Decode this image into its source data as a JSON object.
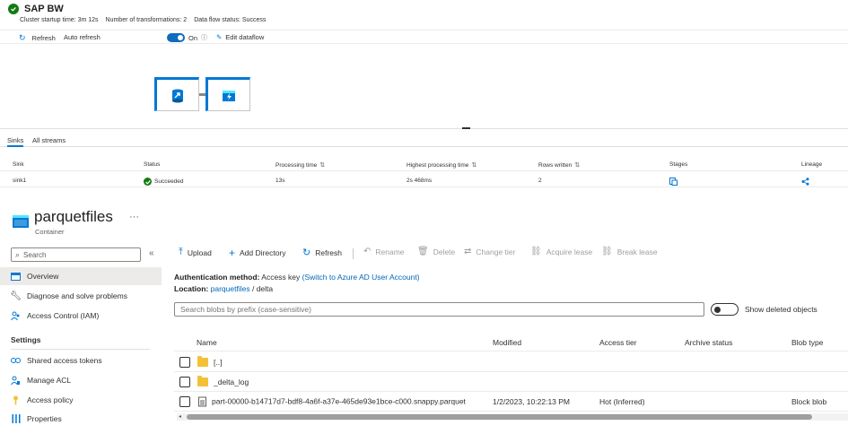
{
  "dataflow": {
    "title": "SAP BW",
    "meta": {
      "startup": "Cluster startup time: 3m 12s",
      "transformations": "Number of transformations: 2",
      "status": "Data flow status: Success"
    },
    "toolbar": {
      "refresh": "Refresh",
      "auto_refresh": "Auto refresh",
      "toggle_label": "On",
      "edit": "Edit dataflow"
    }
  },
  "sinks_panel": {
    "tabs": [
      "Sinks",
      "All streams"
    ],
    "columns": [
      "Sink",
      "Status",
      "Processing time",
      "Highest processing time",
      "Rows written",
      "Stages",
      "Lineage"
    ],
    "rows": [
      {
        "sink": "sink1",
        "status": "Succeeded",
        "processing_time": "13s",
        "highest_processing_time": "2s 468ms",
        "rows_written": "2"
      }
    ]
  },
  "container": {
    "name": "parquetfiles",
    "type": "Container",
    "more": "···"
  },
  "sidebar": {
    "search_placeholder": "Search",
    "collapse": "«",
    "items": [
      {
        "label": "Overview"
      },
      {
        "label": "Diagnose and solve problems"
      },
      {
        "label": "Access Control (IAM)"
      }
    ],
    "settings_heading": "Settings",
    "settings_items": [
      {
        "label": "Shared access tokens"
      },
      {
        "label": "Manage ACL"
      },
      {
        "label": "Access policy"
      },
      {
        "label": "Properties"
      }
    ]
  },
  "commands": {
    "upload": "Upload",
    "add_directory": "Add Directory",
    "refresh": "Refresh",
    "rename": "Rename",
    "delete": "Delete",
    "change_tier": "Change tier",
    "acquire_lease": "Acquire lease",
    "break_lease": "Break lease"
  },
  "info": {
    "auth_label": "Authentication method:",
    "auth_value": "Access key",
    "auth_link": "(Switch to Azure AD User Account)",
    "location_label": "Location:",
    "location_root": "parquetfiles",
    "location_sep": "/",
    "location_path": "delta"
  },
  "blob_search": {
    "placeholder": "Search blobs by prefix (case-sensitive)"
  },
  "show_deleted": "Show deleted objects",
  "blob_table": {
    "columns": {
      "name": "Name",
      "modified": "Modified",
      "access_tier": "Access tier",
      "archive_status": "Archive status",
      "blob_type": "Blob type"
    },
    "rows": [
      {
        "name": "[..]",
        "modified": "",
        "access_tier": "",
        "archive_status": "",
        "blob_type": ""
      },
      {
        "name": "_delta_log",
        "modified": "",
        "access_tier": "",
        "archive_status": "",
        "blob_type": ""
      },
      {
        "name": "part-00000-b14717d7-bdf8-4a6f-a37e-465de93e1bce-c000.snappy.parquet",
        "modified": "1/2/2023, 10:22:13 PM",
        "access_tier": "Hot (Inferred)",
        "archive_status": "",
        "blob_type": "Block blob"
      }
    ]
  }
}
